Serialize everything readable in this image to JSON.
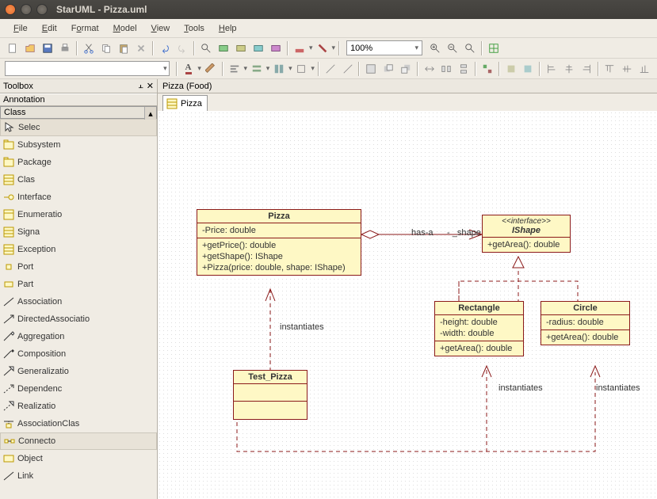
{
  "window": {
    "title": "StarUML - Pizza.uml"
  },
  "menu": {
    "file": "File",
    "edit": "Edit",
    "format": "Format",
    "model": "Model",
    "view": "View",
    "tools": "Tools",
    "help": "Help"
  },
  "toolbar": {
    "zoom": "100%"
  },
  "toolbox": {
    "title": "Toolbox",
    "sections": {
      "annotation": "Annotation",
      "class": "Class"
    },
    "items": {
      "select": "Selec",
      "subsystem": "Subsystem",
      "package": "Package",
      "class": "Clas",
      "interface": "Interface",
      "enumeration": "Enumeratio",
      "signal": "Signa",
      "exception": "Exception",
      "port": "Port",
      "part": "Part",
      "association": "Association",
      "directed": "DirectedAssociatio",
      "aggregation": "Aggregation",
      "composition": "Composition",
      "generalization": "Generalizatio",
      "dependency": "Dependenc",
      "realization": "Realizatio",
      "assocclass": "AssociationClas",
      "connector": "Connecto",
      "object": "Object",
      "link": "Link"
    }
  },
  "breadcrumb": "Pizza (Food)",
  "tab": {
    "label": "Pizza"
  },
  "uml": {
    "pizza": {
      "name": "Pizza",
      "attrs": [
        "-Price: double"
      ],
      "ops": [
        "+getPrice(): double",
        "+getShape(): IShape",
        "+Pizza(price: double, shape: IShape)"
      ]
    },
    "ishape": {
      "stereo": "<<interface>>",
      "name": "IShape",
      "ops": [
        "+getArea(): double"
      ]
    },
    "rectangle": {
      "name": "Rectangle",
      "attrs": [
        "-height: double",
        "-width: double"
      ],
      "ops": [
        "+getArea(): double"
      ]
    },
    "circle": {
      "name": "Circle",
      "attrs": [
        "-radius: double"
      ],
      "ops": [
        "+getArea(): double"
      ]
    },
    "testpizza": {
      "name": "Test_Pizza"
    },
    "labels": {
      "hasa": "has-a",
      "shape": "- _shape",
      "inst": "instantiates"
    }
  }
}
